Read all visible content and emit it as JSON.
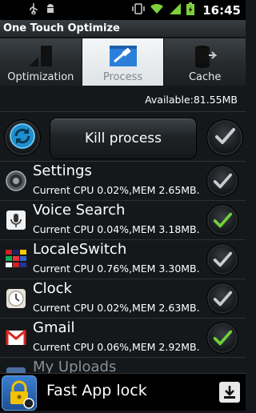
{
  "statusbar": {
    "time": "16:45"
  },
  "app": {
    "title": "One Touch Optimize"
  },
  "tabs": [
    {
      "label": "Optimization",
      "icon": "bars-chart-icon",
      "active": false
    },
    {
      "label": "Process",
      "icon": "hammer-window-icon",
      "active": true
    },
    {
      "label": "Cache",
      "icon": "trash-bin-icon",
      "active": false
    }
  ],
  "available": "Available:81.55MB",
  "actions": {
    "kill_label": "Kill process"
  },
  "processes": [
    {
      "name": "Settings",
      "info": "Current CPU 0.02%,MEM 2.65MB.",
      "checked": false,
      "icon": "settings-icon"
    },
    {
      "name": "Voice Search",
      "info": "Current CPU 0.04%,MEM 3.18MB.",
      "checked": true,
      "icon": "microphone-icon"
    },
    {
      "name": "LocaleSwitch",
      "info": "Current CPU 0.76%,MEM 3.30MB.",
      "checked": false,
      "icon": "flags-icon"
    },
    {
      "name": "Clock",
      "info": "Current CPU 0.02%,MEM 2.63MB.",
      "checked": false,
      "icon": "clock-icon"
    },
    {
      "name": "Gmail",
      "info": "Current CPU 0.06%,MEM 2.92MB.",
      "checked": true,
      "icon": "gmail-icon"
    },
    {
      "name": "My Uploads",
      "info": "",
      "checked": false,
      "icon": "upload-icon"
    }
  ],
  "ad": {
    "text": "Fast App lock"
  },
  "colors": {
    "check_green": "#6fd13a",
    "check_gray": "#c9cdd0",
    "refresh_blue": "#2fb3e8"
  }
}
